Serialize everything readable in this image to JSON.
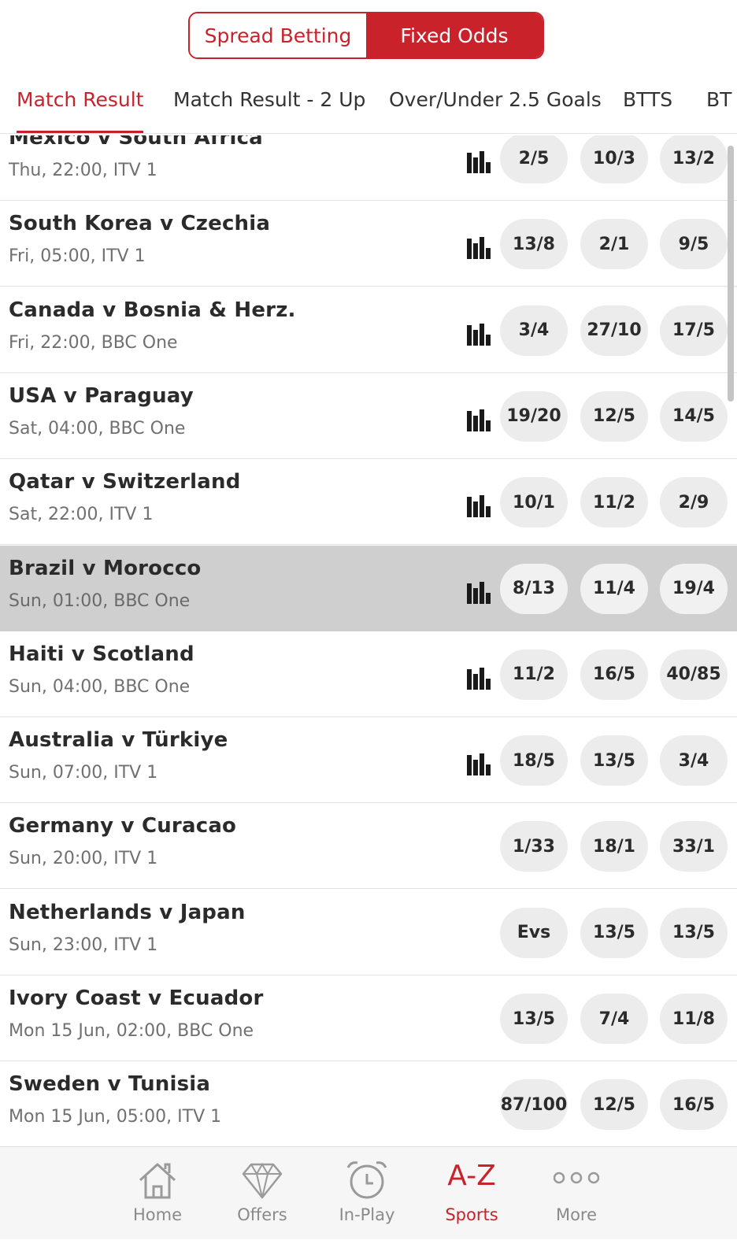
{
  "toggle": {
    "left_label": "Spread Betting",
    "right_label": "Fixed Odds"
  },
  "tabs": [
    {
      "label": "Match Result"
    },
    {
      "label": "Match Result - 2 Up"
    },
    {
      "label": "Over/Under 2.5 Goals"
    },
    {
      "label": "BTTS"
    },
    {
      "label": "BT"
    }
  ],
  "matches": [
    {
      "name": "Mexico v South Africa",
      "time": "Thu, 22:00",
      "channel": "ITV 1",
      "odds": [
        "2/5",
        "10/3",
        "13/2"
      ],
      "stats": true
    },
    {
      "name": "South Korea v Czechia",
      "time": "Fri, 05:00",
      "channel": "ITV 1",
      "odds": [
        "13/8",
        "2/1",
        "9/5"
      ],
      "stats": true
    },
    {
      "name": "Canada v Bosnia & Herz.",
      "time": "Fri, 22:00",
      "channel": "BBC One",
      "odds": [
        "3/4",
        "27/10",
        "17/5"
      ],
      "stats": true
    },
    {
      "name": "USA v Paraguay",
      "time": "Sat, 04:00",
      "channel": "BBC One",
      "odds": [
        "19/20",
        "12/5",
        "14/5"
      ],
      "stats": true
    },
    {
      "name": "Qatar v Switzerland",
      "time": "Sat, 22:00",
      "channel": "ITV 1",
      "odds": [
        "10/1",
        "11/2",
        "2/9"
      ],
      "stats": true
    },
    {
      "name": "Brazil v Morocco",
      "time": "Sun, 01:00",
      "channel": "BBC One",
      "odds": [
        "8/13",
        "11/4",
        "19/4"
      ],
      "stats": true
    },
    {
      "name": "Haiti v Scotland",
      "time": "Sun, 04:00",
      "channel": "BBC One",
      "odds": [
        "11/2",
        "16/5",
        "40/85"
      ],
      "stats": true
    },
    {
      "name": "Australia v Türkiye",
      "time": "Sun, 07:00",
      "channel": "ITV 1",
      "odds": [
        "18/5",
        "13/5",
        "3/4"
      ],
      "stats": true
    },
    {
      "name": "Germany v Curacao",
      "time": "Sun, 20:00",
      "channel": "ITV 1",
      "odds": [
        "1/33",
        "18/1",
        "33/1"
      ],
      "stats": false
    },
    {
      "name": "Netherlands v Japan",
      "time": "Sun, 23:00",
      "channel": "ITV 1",
      "odds": [
        "Evs",
        "13/5",
        "13/5"
      ],
      "stats": false
    },
    {
      "name": "Ivory Coast v Ecuador",
      "time": "Mon 15 Jun, 02:00",
      "channel": "BBC One",
      "odds": [
        "13/5",
        "7/4",
        "11/8"
      ],
      "stats": false
    },
    {
      "name": "Sweden v Tunisia",
      "time": "Mon 15 Jun, 05:00",
      "channel": "ITV 1",
      "odds": [
        "87/100",
        "12/5",
        "16/5"
      ],
      "stats": false
    }
  ],
  "nav": {
    "home": "Home",
    "offers": "Offers",
    "inplay": "In-Play",
    "sports_glyph": "A-Z",
    "sports": "Sports",
    "more": "More"
  },
  "colors": {
    "accent": "#c9222b",
    "highlight_row": "#cfcfcf"
  }
}
